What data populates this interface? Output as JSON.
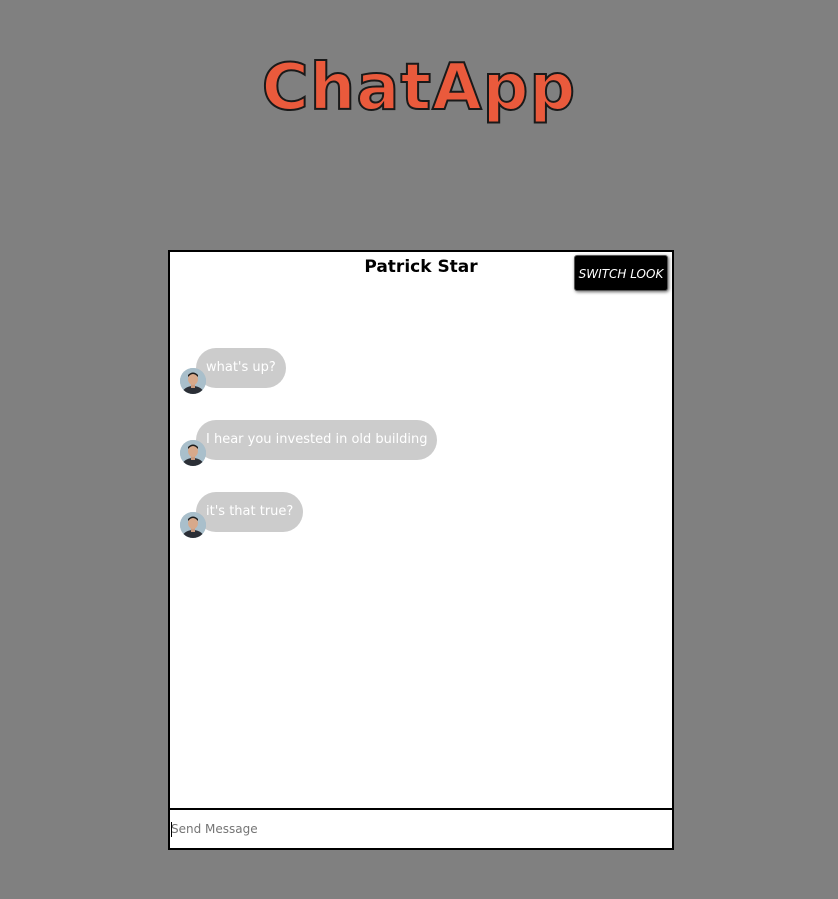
{
  "app": {
    "title": "ChatApp"
  },
  "chat": {
    "contact_name": "Patrick Star",
    "switch_look_label": "SWITCH LOOK",
    "messages": [
      {
        "text": "what's up?",
        "avatar": "person-avatar-icon"
      },
      {
        "text": "I hear you invested in old building",
        "avatar": "person-avatar-icon"
      },
      {
        "text": "it's that true?",
        "avatar": "person-avatar-icon"
      }
    ]
  },
  "composer": {
    "placeholder": "Send Message",
    "value": ""
  },
  "colors": {
    "background": "#808080",
    "title": "#ea5a3c",
    "bubble": "#cccccc",
    "bubble_text": "#ffffff",
    "button_bg": "#000000"
  }
}
